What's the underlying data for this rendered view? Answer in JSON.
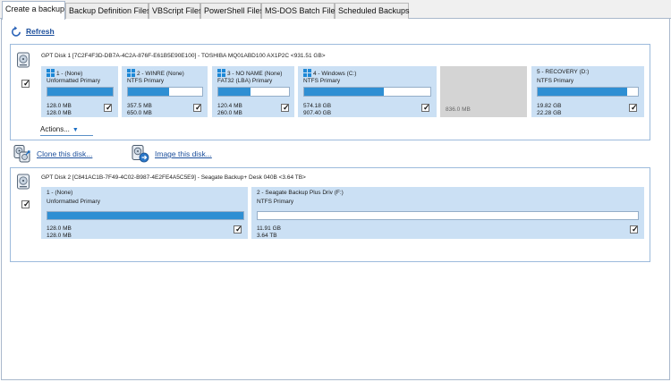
{
  "tabs": [
    {
      "label": "Create a backup",
      "active": true
    },
    {
      "label": "Backup Definition Files",
      "active": false
    },
    {
      "label": "VBScript Files",
      "active": false
    },
    {
      "label": "PowerShell Files",
      "active": false
    },
    {
      "label": "MS-DOS Batch Files",
      "active": false
    },
    {
      "label": "Scheduled Backups",
      "active": false
    }
  ],
  "toolbar": {
    "refresh_label": "Refresh",
    "refresh_icon": "refresh-icon"
  },
  "disk1": {
    "title": "GPT Disk 1 [7C2F4F3D-DB7A-4C2A-876F-E61B5E90E100] - TOSHIBA MQ01ABD100 AX1P2C  <931.51 GB>",
    "checked": true,
    "partitions": [
      {
        "name": "1 -  (None)",
        "type": "Unformatted Primary",
        "used": "128.0 MB",
        "total": "128.0 MB",
        "fill_pct": 100,
        "checked": true,
        "windows_logo": true
      },
      {
        "name": "2 - WINRE (None)",
        "type": "NTFS Primary",
        "used": "357.5 MB",
        "total": "650.0 MB",
        "fill_pct": 55,
        "checked": true,
        "windows_logo": true
      },
      {
        "name": "3 - NO NAME (None)",
        "type": "FAT32 (LBA) Primary",
        "used": "120.4 MB",
        "total": "260.0 MB",
        "fill_pct": 46,
        "checked": true,
        "windows_logo": true
      },
      {
        "name": "4 - Windows (C:)",
        "type": "NTFS Primary",
        "used": "574.18 GB",
        "total": "907.40 GB",
        "fill_pct": 63,
        "checked": true,
        "windows_logo": true
      },
      {
        "name": "",
        "type": "",
        "used": "",
        "total": "836.0 MB",
        "unallocated": true
      },
      {
        "name": "5 - RECOVERY (D:)",
        "type": "NTFS Primary",
        "used": "19.82 GB",
        "total": "22.28 GB",
        "fill_pct": 89,
        "checked": true,
        "windows_logo": false
      }
    ],
    "actions_label": "Actions..."
  },
  "links": {
    "clone_label": "Clone this disk...",
    "image_label": "Image this disk..."
  },
  "disk2": {
    "title": "GPT Disk 2 [C841AC1B-7F49-4C02-B987-4E2FE4A5C5E9] - Seagate  Backup+  Desk    040B  <3.64 TB>",
    "checked": true,
    "partitions": [
      {
        "name": "1 -  (None)",
        "type": "Unformatted Primary",
        "used": "128.0 MB",
        "total": "128.0 MB",
        "fill_pct": 100,
        "checked": true
      },
      {
        "name": "2 - Seagate Backup Plus Driv (F:)",
        "type": "NTFS Primary",
        "used": "11.91 GB",
        "total": "3.64 TB",
        "fill_pct": 0,
        "checked": true
      }
    ]
  },
  "colors": {
    "accent": "#1c4f9c",
    "bar_fill": "#2f8fd3",
    "partition_bg": "#cbe0f4",
    "unallocated_bg": "#d4d4d4",
    "border": "#9dbbdc"
  }
}
